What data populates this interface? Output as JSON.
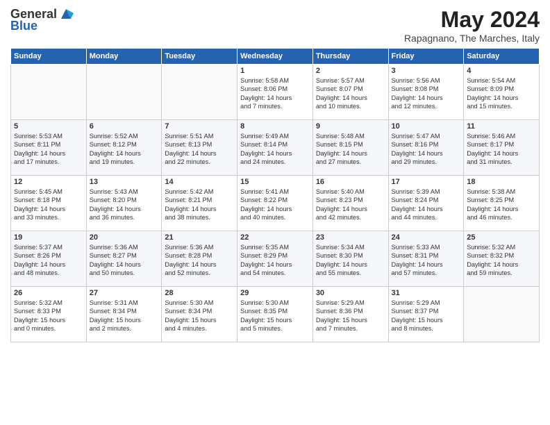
{
  "header": {
    "logo_line1": "General",
    "logo_line2": "Blue",
    "month_title": "May 2024",
    "subtitle": "Rapagnano, The Marches, Italy"
  },
  "weekdays": [
    "Sunday",
    "Monday",
    "Tuesday",
    "Wednesday",
    "Thursday",
    "Friday",
    "Saturday"
  ],
  "weeks": [
    [
      {
        "day": "",
        "detail": ""
      },
      {
        "day": "",
        "detail": ""
      },
      {
        "day": "",
        "detail": ""
      },
      {
        "day": "1",
        "detail": "Sunrise: 5:58 AM\nSunset: 8:06 PM\nDaylight: 14 hours\nand 7 minutes."
      },
      {
        "day": "2",
        "detail": "Sunrise: 5:57 AM\nSunset: 8:07 PM\nDaylight: 14 hours\nand 10 minutes."
      },
      {
        "day": "3",
        "detail": "Sunrise: 5:56 AM\nSunset: 8:08 PM\nDaylight: 14 hours\nand 12 minutes."
      },
      {
        "day": "4",
        "detail": "Sunrise: 5:54 AM\nSunset: 8:09 PM\nDaylight: 14 hours\nand 15 minutes."
      }
    ],
    [
      {
        "day": "5",
        "detail": "Sunrise: 5:53 AM\nSunset: 8:11 PM\nDaylight: 14 hours\nand 17 minutes."
      },
      {
        "day": "6",
        "detail": "Sunrise: 5:52 AM\nSunset: 8:12 PM\nDaylight: 14 hours\nand 19 minutes."
      },
      {
        "day": "7",
        "detail": "Sunrise: 5:51 AM\nSunset: 8:13 PM\nDaylight: 14 hours\nand 22 minutes."
      },
      {
        "day": "8",
        "detail": "Sunrise: 5:49 AM\nSunset: 8:14 PM\nDaylight: 14 hours\nand 24 minutes."
      },
      {
        "day": "9",
        "detail": "Sunrise: 5:48 AM\nSunset: 8:15 PM\nDaylight: 14 hours\nand 27 minutes."
      },
      {
        "day": "10",
        "detail": "Sunrise: 5:47 AM\nSunset: 8:16 PM\nDaylight: 14 hours\nand 29 minutes."
      },
      {
        "day": "11",
        "detail": "Sunrise: 5:46 AM\nSunset: 8:17 PM\nDaylight: 14 hours\nand 31 minutes."
      }
    ],
    [
      {
        "day": "12",
        "detail": "Sunrise: 5:45 AM\nSunset: 8:18 PM\nDaylight: 14 hours\nand 33 minutes."
      },
      {
        "day": "13",
        "detail": "Sunrise: 5:43 AM\nSunset: 8:20 PM\nDaylight: 14 hours\nand 36 minutes."
      },
      {
        "day": "14",
        "detail": "Sunrise: 5:42 AM\nSunset: 8:21 PM\nDaylight: 14 hours\nand 38 minutes."
      },
      {
        "day": "15",
        "detail": "Sunrise: 5:41 AM\nSunset: 8:22 PM\nDaylight: 14 hours\nand 40 minutes."
      },
      {
        "day": "16",
        "detail": "Sunrise: 5:40 AM\nSunset: 8:23 PM\nDaylight: 14 hours\nand 42 minutes."
      },
      {
        "day": "17",
        "detail": "Sunrise: 5:39 AM\nSunset: 8:24 PM\nDaylight: 14 hours\nand 44 minutes."
      },
      {
        "day": "18",
        "detail": "Sunrise: 5:38 AM\nSunset: 8:25 PM\nDaylight: 14 hours\nand 46 minutes."
      }
    ],
    [
      {
        "day": "19",
        "detail": "Sunrise: 5:37 AM\nSunset: 8:26 PM\nDaylight: 14 hours\nand 48 minutes."
      },
      {
        "day": "20",
        "detail": "Sunrise: 5:36 AM\nSunset: 8:27 PM\nDaylight: 14 hours\nand 50 minutes."
      },
      {
        "day": "21",
        "detail": "Sunrise: 5:36 AM\nSunset: 8:28 PM\nDaylight: 14 hours\nand 52 minutes."
      },
      {
        "day": "22",
        "detail": "Sunrise: 5:35 AM\nSunset: 8:29 PM\nDaylight: 14 hours\nand 54 minutes."
      },
      {
        "day": "23",
        "detail": "Sunrise: 5:34 AM\nSunset: 8:30 PM\nDaylight: 14 hours\nand 55 minutes."
      },
      {
        "day": "24",
        "detail": "Sunrise: 5:33 AM\nSunset: 8:31 PM\nDaylight: 14 hours\nand 57 minutes."
      },
      {
        "day": "25",
        "detail": "Sunrise: 5:32 AM\nSunset: 8:32 PM\nDaylight: 14 hours\nand 59 minutes."
      }
    ],
    [
      {
        "day": "26",
        "detail": "Sunrise: 5:32 AM\nSunset: 8:33 PM\nDaylight: 15 hours\nand 0 minutes."
      },
      {
        "day": "27",
        "detail": "Sunrise: 5:31 AM\nSunset: 8:34 PM\nDaylight: 15 hours\nand 2 minutes."
      },
      {
        "day": "28",
        "detail": "Sunrise: 5:30 AM\nSunset: 8:34 PM\nDaylight: 15 hours\nand 4 minutes."
      },
      {
        "day": "29",
        "detail": "Sunrise: 5:30 AM\nSunset: 8:35 PM\nDaylight: 15 hours\nand 5 minutes."
      },
      {
        "day": "30",
        "detail": "Sunrise: 5:29 AM\nSunset: 8:36 PM\nDaylight: 15 hours\nand 7 minutes."
      },
      {
        "day": "31",
        "detail": "Sunrise: 5:29 AM\nSunset: 8:37 PM\nDaylight: 15 hours\nand 8 minutes."
      },
      {
        "day": "",
        "detail": ""
      }
    ]
  ]
}
